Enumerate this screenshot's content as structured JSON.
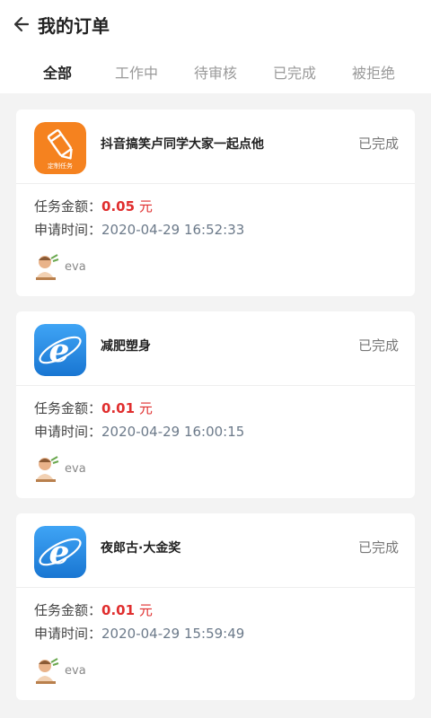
{
  "header": {
    "title": "我的订单"
  },
  "tabs": [
    {
      "label": "全部",
      "active": true
    },
    {
      "label": "工作中",
      "active": false
    },
    {
      "label": "待审核",
      "active": false
    },
    {
      "label": "已完成",
      "active": false
    },
    {
      "label": "被拒绝",
      "active": false
    }
  ],
  "orders": [
    {
      "icon": "custom-task-icon",
      "icon_text": "定制任务",
      "title": "抖音搞笑卢同学大家一起点他",
      "status": "已完成",
      "amount_label": "任务金额：",
      "amount": "0.05",
      "unit": "元",
      "time_label": "申请时间：",
      "time": "2020-04-29 16:52:33",
      "user": "eva"
    },
    {
      "icon": "ie-browser-icon",
      "title": "减肥塑身",
      "status": "已完成",
      "amount_label": "任务金额：",
      "amount": "0.01",
      "unit": "元",
      "time_label": "申请时间：",
      "time": "2020-04-29 16:00:15",
      "user": "eva"
    },
    {
      "icon": "ie-browser-icon",
      "title": "夜郎古·大金奖",
      "status": "已完成",
      "amount_label": "任务金额：",
      "amount": "0.01",
      "unit": "元",
      "time_label": "申请时间：",
      "time": "2020-04-29 15:59:49",
      "user": "eva"
    }
  ],
  "colors": {
    "accent_red": "#e02e2e",
    "orange_icon": "#f5821f",
    "ie_blue": "#1e88e5"
  }
}
